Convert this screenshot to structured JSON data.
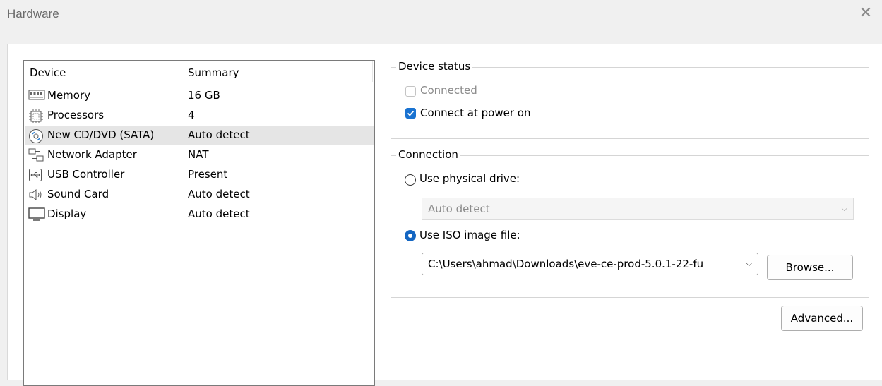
{
  "window": {
    "title": "Hardware",
    "close_glyph": "✕"
  },
  "device_list": {
    "headers": {
      "device": "Device",
      "summary": "Summary"
    },
    "items": [
      {
        "icon": "memory-icon",
        "name": "Memory",
        "summary": "16 GB"
      },
      {
        "icon": "processor-icon",
        "name": "Processors",
        "summary": "4"
      },
      {
        "icon": "cd-dvd-icon",
        "name": "New CD/DVD (SATA)",
        "summary": "Auto detect",
        "selected": true
      },
      {
        "icon": "network-adapter-icon",
        "name": "Network Adapter",
        "summary": "NAT"
      },
      {
        "icon": "usb-icon",
        "name": "USB Controller",
        "summary": "Present"
      },
      {
        "icon": "speaker-icon",
        "name": "Sound Card",
        "summary": "Auto detect"
      },
      {
        "icon": "display-icon",
        "name": "Display",
        "summary": "Auto detect"
      }
    ]
  },
  "device_status": {
    "legend": "Device status",
    "connected": {
      "label": "Connected",
      "checked": false,
      "disabled": true
    },
    "connect_at_power_on": {
      "label": "Connect at power on",
      "checked": true
    }
  },
  "connection": {
    "legend": "Connection",
    "use_physical_drive": {
      "label": "Use physical drive:",
      "selected": false
    },
    "physical_drive_select": {
      "value": "Auto detect",
      "disabled": true
    },
    "use_iso_image": {
      "label": "Use ISO image file:",
      "selected": true
    },
    "iso_path": {
      "value": "C:\\Users\\ahmad\\Downloads\\eve-ce-prod-5.0.1-22-fu"
    },
    "browse_label": "Browse..."
  },
  "advanced_label": "Advanced...",
  "colors": {
    "accent": "#1a73d1",
    "selected_row": "#e5e5e5"
  }
}
